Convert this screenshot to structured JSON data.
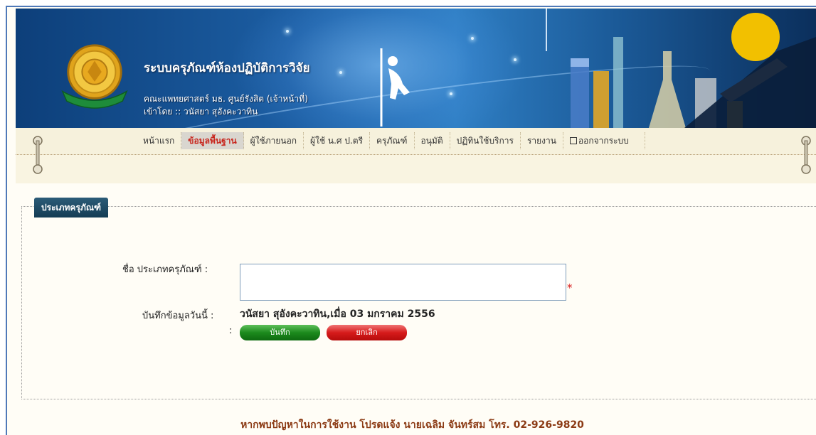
{
  "header": {
    "title": "ระบบครุภัณฑ์ห้องปฏิบัติการวิจัย",
    "subtitle": "คณะแพทยศาสตร์ มธ. ศูนย์รังสิต (เจ้าหน้าที่)",
    "logged_in": "เข้าโดย :: วนัสยา สุอังคะวาทิน"
  },
  "nav": {
    "items": [
      {
        "label": "หน้าแรก"
      },
      {
        "label": "ข้อมูลพื้นฐาน"
      },
      {
        "label": "ผู้ใช้ภายนอก"
      },
      {
        "label": "ผู้ใช้ น.ศ ป.ตรี"
      },
      {
        "label": "ครุภัณฑ์"
      },
      {
        "label": "อนุมัติ"
      },
      {
        "label": "ปฏิทินใช้บริการ"
      },
      {
        "label": "รายงาน"
      },
      {
        "label": "ออกจากระบบ"
      }
    ]
  },
  "form": {
    "legend": "ประเภทครุภัณฑ์",
    "name_label": "ชื่อ ประเภทครุภัณฑ์ :",
    "name_value": "",
    "required_mark": "*",
    "recorded_label": "บันทึกข้อมูลวันนี้ :",
    "recorded_value": "วนัสยา สุอังคะวาทิน,เมื่อ 03 มกราคม 2556",
    "buttons_colon": ":",
    "save_label": "บันทึก",
    "cancel_label": "ยกเลิก"
  },
  "footer": {
    "text": "หากพบปัญหาในการใช้งาน โปรดแจ้ง นายเฉลิม จันทร์สม โทร. 02-926-9820"
  },
  "colors": {
    "banner": "#1c5ea3",
    "nav_active_text": "#c8261d",
    "legend_bg": "#1f4b64",
    "save_button": "#1c8a1d",
    "cancel_button": "#d61b1b",
    "footer_text": "#8b3a14"
  }
}
